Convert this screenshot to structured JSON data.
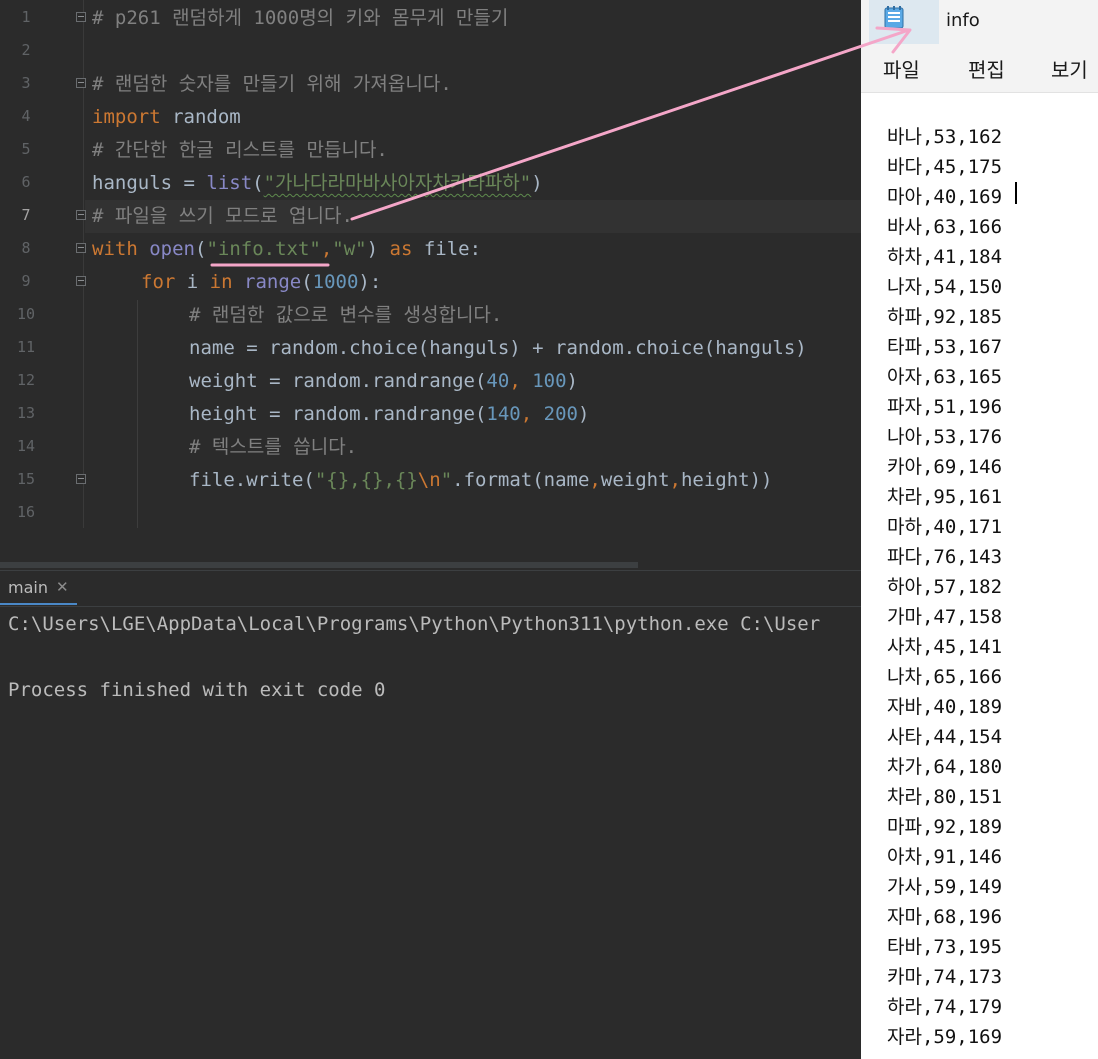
{
  "editor": {
    "line_numbers": [
      "1",
      "2",
      "3",
      "4",
      "5",
      "6",
      "7",
      "8",
      "9",
      "10",
      "11",
      "12",
      "13",
      "14",
      "15",
      "16"
    ],
    "lines": {
      "l1": "# p261 랜덤하게 1000명의 키와 몸무게 만들기",
      "l3": "# 랜덤한 숫자를 만들기 위해 가져옵니다.",
      "l4_kw": "import",
      "l4_rest": " random",
      "l5": "# 간단한 한글 리스트를 만듭니다.",
      "l6_var": "hanguls = ",
      "l6_fn": "list",
      "l6_p1": "(",
      "l6_str": "\"가나다라마바사아자차카타파하\"",
      "l6_p2": ")",
      "l7": "# 파일을 쓰기 모드로 엽니다.",
      "l8_kw1": "with",
      "l8_sp": " ",
      "l8_fn": "open",
      "l8_p1": "(",
      "l8_str1": "\"info.txt\"",
      "l8_comma": ",",
      "l8_str2": "\"w\"",
      "l8_p2": ") ",
      "l8_kw2": "as",
      "l8_rest": " file:",
      "l9_kw1": "for",
      "l9_mid": " i ",
      "l9_kw2": "in",
      "l9_sp": " ",
      "l9_fn": "range",
      "l9_p1": "(",
      "l9_num": "1000",
      "l9_p2": "):",
      "l10": "# 랜덤한 값으로 변수를 생성합니다.",
      "l11": "name = random.choice(hanguls) + random.choice(hanguls)",
      "l12_a": "weight = random.randrange(",
      "l12_n1": "40",
      "l12_c": ", ",
      "l12_n2": "100",
      "l12_z": ")",
      "l13_a": "height = random.randrange(",
      "l13_n1": "140",
      "l13_c": ", ",
      "l13_n2": "200",
      "l13_z": ")",
      "l14": "# 텍스트를 씁니다.",
      "l15_a": "file.write(",
      "l15_str": "\"{},{},{}",
      "l15_esc": "\\n",
      "l15_q": "\"",
      "l15_b": ".format(name",
      "l15_c1": ",",
      "l15_w": "weight",
      "l15_c2": ",",
      "l15_h": "height))"
    }
  },
  "run": {
    "tab_label": "main",
    "close_glyph": "✕",
    "output": [
      "C:\\Users\\LGE\\AppData\\Local\\Programs\\Python\\Python311\\python.exe C:\\User",
      "",
      "Process finished with exit code 0"
    ]
  },
  "notepad": {
    "title": "info",
    "menu": [
      "파일",
      "편집",
      "보기"
    ],
    "lines": [
      "바나,53,162",
      "바다,45,175",
      "마아,40,169",
      "바사,63,166",
      "하차,41,184",
      "나자,54,150",
      "하파,92,185",
      "타파,53,167",
      "아자,63,165",
      "파자,51,196",
      "나아,53,176",
      "카아,69,146",
      "차라,95,161",
      "마하,40,171",
      "파다,76,143",
      "하아,57,182",
      "가마,47,158",
      "사차,45,141",
      "나차,65,166",
      "자바,40,189",
      "사타,44,154",
      "차가,64,180",
      "차라,80,151",
      "마파,92,189",
      "아차,91,146",
      "가사,59,149",
      "자마,68,196",
      "타바,73,195",
      "카마,74,173",
      "하라,74,179",
      "자라,59,169"
    ]
  },
  "colors": {
    "editor_bg": "#2b2b2b",
    "comment": "#808080",
    "keyword": "#cc7832",
    "string": "#6a8759",
    "number": "#6897bb",
    "annotation": "#f4a6c8"
  },
  "icons": [
    "notepad-icon",
    "close-icon",
    "fold-marker-icon"
  ]
}
